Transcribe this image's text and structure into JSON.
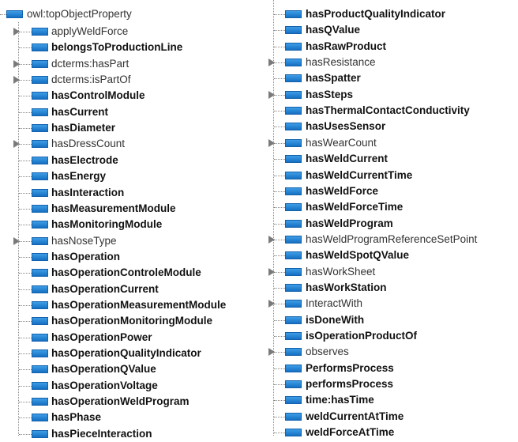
{
  "root": {
    "label": "owl:topObjectProperty"
  },
  "left_items": [
    {
      "label": "applyWeldForce",
      "bold": false,
      "expandable": true
    },
    {
      "label": "belongsToProductionLine",
      "bold": true,
      "expandable": false
    },
    {
      "label": "dcterms:hasPart",
      "bold": false,
      "expandable": true
    },
    {
      "label": "dcterms:isPartOf",
      "bold": false,
      "expandable": true
    },
    {
      "label": "hasControlModule",
      "bold": true,
      "expandable": false
    },
    {
      "label": "hasCurrent",
      "bold": true,
      "expandable": false
    },
    {
      "label": "hasDiameter",
      "bold": true,
      "expandable": false
    },
    {
      "label": "hasDressCount",
      "bold": false,
      "expandable": true
    },
    {
      "label": "hasElectrode",
      "bold": true,
      "expandable": false
    },
    {
      "label": "hasEnergy",
      "bold": true,
      "expandable": false
    },
    {
      "label": "hasInteraction",
      "bold": true,
      "expandable": false
    },
    {
      "label": "hasMeasurementModule",
      "bold": true,
      "expandable": false
    },
    {
      "label": "hasMonitoringModule",
      "bold": true,
      "expandable": false
    },
    {
      "label": "hasNoseType",
      "bold": false,
      "expandable": true
    },
    {
      "label": "hasOperation",
      "bold": true,
      "expandable": false
    },
    {
      "label": "hasOperationControleModule",
      "bold": true,
      "expandable": false
    },
    {
      "label": "hasOperationCurrent",
      "bold": true,
      "expandable": false
    },
    {
      "label": "hasOperationMeasurementModule",
      "bold": true,
      "expandable": false
    },
    {
      "label": "hasOperationMonitoringModule",
      "bold": true,
      "expandable": false
    },
    {
      "label": "hasOperationPower",
      "bold": true,
      "expandable": false
    },
    {
      "label": "hasOperationQualityIndicator",
      "bold": true,
      "expandable": false
    },
    {
      "label": "hasOperationQValue",
      "bold": true,
      "expandable": false
    },
    {
      "label": "hasOperationVoltage",
      "bold": true,
      "expandable": false
    },
    {
      "label": "hasOperationWeldProgram",
      "bold": true,
      "expandable": false
    },
    {
      "label": "hasPhase",
      "bold": true,
      "expandable": false
    },
    {
      "label": "hasPieceInteraction",
      "bold": true,
      "expandable": false
    }
  ],
  "right_items": [
    {
      "label": "hasProductQualityIndicator",
      "bold": true,
      "expandable": false
    },
    {
      "label": "hasQValue",
      "bold": true,
      "expandable": false
    },
    {
      "label": "hasRawProduct",
      "bold": true,
      "expandable": false
    },
    {
      "label": "hasResistance",
      "bold": false,
      "expandable": true
    },
    {
      "label": "hasSpatter",
      "bold": true,
      "expandable": false
    },
    {
      "label": "hasSteps",
      "bold": true,
      "expandable": true
    },
    {
      "label": "hasThermalContactConductivity",
      "bold": true,
      "expandable": false
    },
    {
      "label": "hasUsesSensor",
      "bold": true,
      "expandable": false
    },
    {
      "label": "hasWearCount",
      "bold": false,
      "expandable": true
    },
    {
      "label": "hasWeldCurrent",
      "bold": true,
      "expandable": false
    },
    {
      "label": "hasWeldCurrentTime",
      "bold": true,
      "expandable": false
    },
    {
      "label": "hasWeldForce",
      "bold": true,
      "expandable": false
    },
    {
      "label": "hasWeldForceTime",
      "bold": true,
      "expandable": false
    },
    {
      "label": "hasWeldProgram",
      "bold": true,
      "expandable": false
    },
    {
      "label": "hasWeldProgramReferenceSetPoint",
      "bold": false,
      "expandable": true
    },
    {
      "label": "hasWeldSpotQValue",
      "bold": true,
      "expandable": false
    },
    {
      "label": "hasWorkSheet",
      "bold": false,
      "expandable": true
    },
    {
      "label": "hasWorkStation",
      "bold": true,
      "expandable": false
    },
    {
      "label": "InteractWith",
      "bold": false,
      "expandable": true
    },
    {
      "label": "isDoneWith",
      "bold": true,
      "expandable": false
    },
    {
      "label": "isOperationProductOf",
      "bold": true,
      "expandable": false
    },
    {
      "label": "observes",
      "bold": false,
      "expandable": true
    },
    {
      "label": "PerformsProcess",
      "bold": true,
      "expandable": false
    },
    {
      "label": "performsProcess",
      "bold": true,
      "expandable": false
    },
    {
      "label": "time:hasTime",
      "bold": true,
      "expandable": false
    },
    {
      "label": "weldCurrentAtTime",
      "bold": true,
      "expandable": false
    },
    {
      "label": "weldForceAtTime",
      "bold": true,
      "expandable": false
    }
  ],
  "colors": {
    "property_icon": "#1670c3",
    "expander": "#7a7a7a",
    "tree_line": "#888888"
  }
}
